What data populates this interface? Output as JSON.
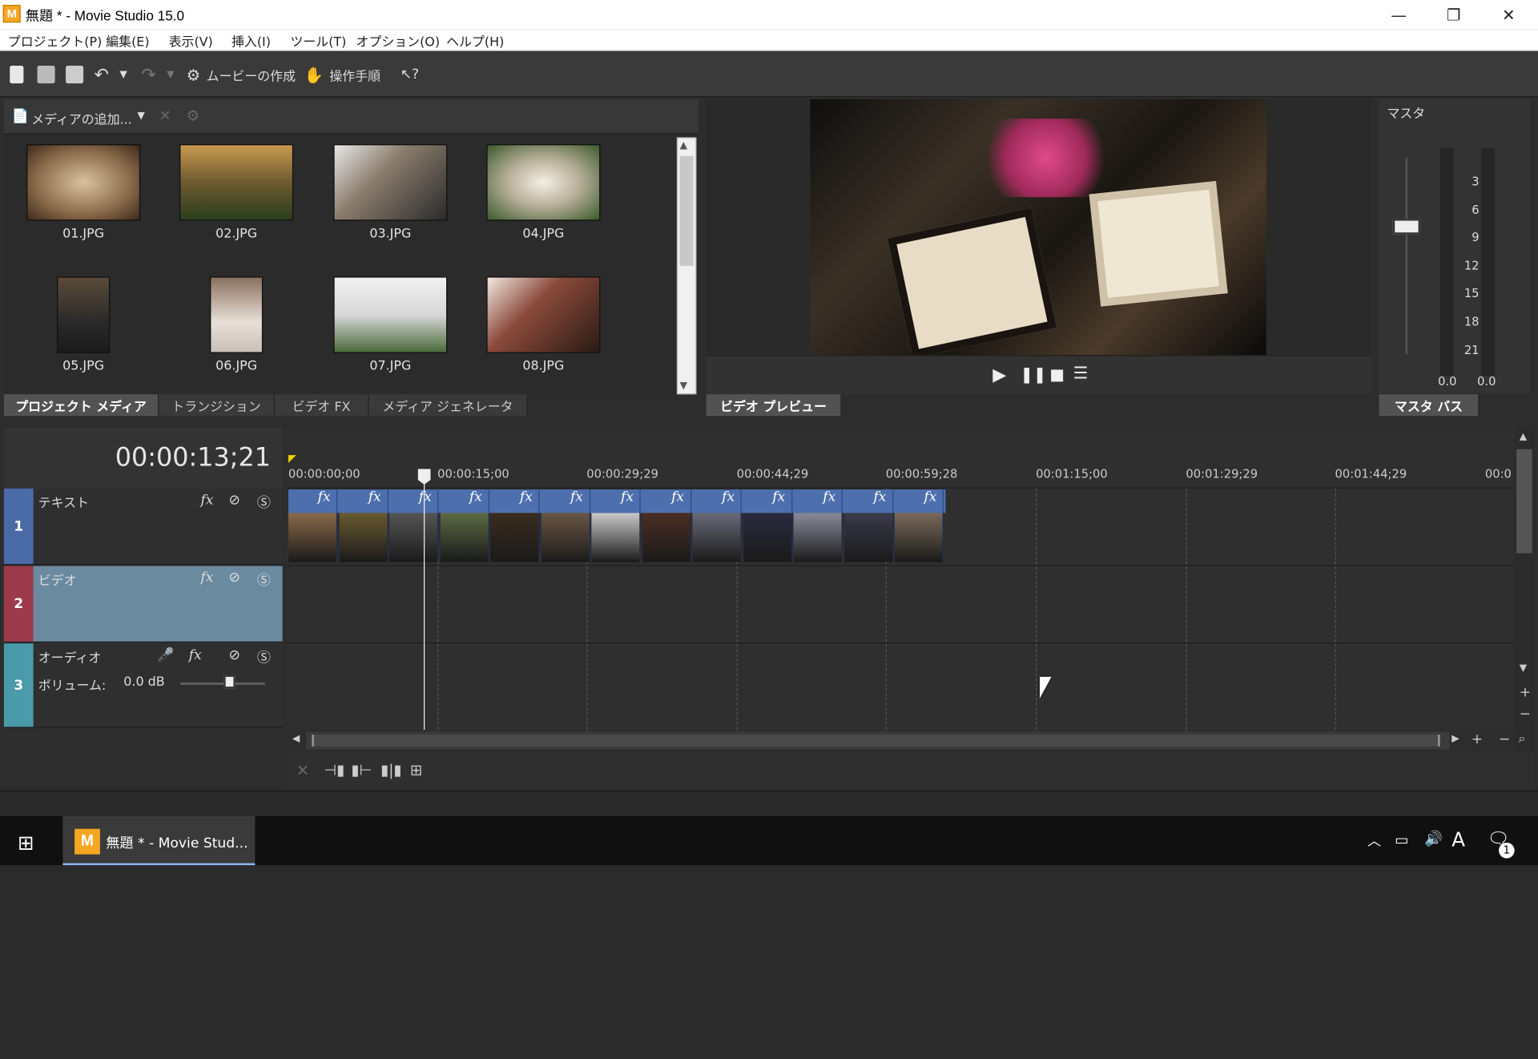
{
  "window": {
    "title": "無題 * - Movie Studio 15.0",
    "app_icon_letter": "M",
    "minimize": "—",
    "restore": "❐",
    "close": "✕"
  },
  "menu": [
    "プロジェクト(P)",
    "編集(E)",
    "表示(V)",
    "挿入(I)",
    "ツール(T)",
    "オプション(O)",
    "ヘルプ(H)"
  ],
  "toolbar": {
    "make_movie": "ムービーの作成",
    "steps": "操作手順"
  },
  "media": {
    "add_label": "メディアの追加...",
    "items": [
      {
        "label": "01.JPG",
        "color": "#7a5a3a"
      },
      {
        "label": "02.JPG",
        "color": "#4a3a22"
      },
      {
        "label": "03.JPG",
        "color": "#555555"
      },
      {
        "label": "04.JPG",
        "color": "#5d6a44"
      },
      {
        "label": "05.JPG",
        "color": "#3a2c20"
      },
      {
        "label": "06.JPG",
        "color": "#6a5646"
      },
      {
        "label": "07.JPG",
        "color": "#c9c9c9"
      },
      {
        "label": "08.JPG",
        "color": "#4a2e24"
      }
    ],
    "tabs": [
      "プロジェクト メディア",
      "トランジション",
      "ビデオ FX",
      "メディア ジェネレータ"
    ]
  },
  "preview": {
    "tab": "ビデオ プレビュー"
  },
  "master": {
    "label": "マスタ",
    "scale": [
      "3",
      "6",
      "9",
      "12",
      "15",
      "18",
      "21"
    ],
    "left_value": "0.0",
    "right_value": "0.0",
    "tab": "マスタ バス"
  },
  "timeline": {
    "timecode": "00:00:13;21",
    "ruler": [
      "00:00:00;00",
      "00:00:15;00",
      "00:00:29;29",
      "00:00:44;29",
      "00:00:59;28",
      "00:01:15;00",
      "00:01:29;29",
      "00:01:44;29",
      "00:0"
    ],
    "tracks": [
      {
        "number": "1",
        "name": "テキスト",
        "color": "#4b6aa8"
      },
      {
        "number": "2",
        "name": "ビデオ",
        "color": "#9c3a4c"
      },
      {
        "number": "3",
        "name": "オーディオ",
        "color": "#4a9aaa",
        "volume_label": "ボリューム:",
        "volume_value": "0.0 dB"
      }
    ],
    "fx_label": "fx",
    "clip_count": 13,
    "playhead_label": "00:00:13;21"
  },
  "taskbar": {
    "app_label": "無題 * - Movie Stud...",
    "ime": "A",
    "notifications": "1"
  }
}
